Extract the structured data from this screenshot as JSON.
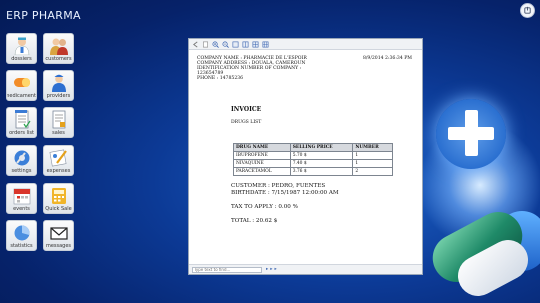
{
  "app": {
    "title": "ERP PHARMA"
  },
  "tiles": [
    {
      "label": "dossiers",
      "icon": "doctor-icon"
    },
    {
      "label": "customers",
      "icon": "customers-icon"
    },
    {
      "label": "medicaments",
      "icon": "medicaments-icon"
    },
    {
      "label": "providers",
      "icon": "providers-icon"
    },
    {
      "label": "orders list",
      "icon": "orders-list-icon"
    },
    {
      "label": "sales",
      "icon": "sales-icon"
    },
    {
      "label": "settings",
      "icon": "settings-icon"
    },
    {
      "label": "expenses",
      "icon": "expenses-icon"
    },
    {
      "label": "events",
      "icon": "calendar-icon"
    },
    {
      "label": "Quick Sale",
      "icon": "quick-sale-icon"
    },
    {
      "label": "statistics",
      "icon": "statistics-icon"
    },
    {
      "label": "messages",
      "icon": "envelope-icon"
    }
  ],
  "viewer": {
    "find_placeholder": "Type text to find...",
    "report": {
      "company_line": "COMPANY NAME : PHARMACIE DE L'ESPOIR",
      "address_line": "COMPANY ADDRESS : DOUALA, CAMEROUN",
      "id_line": "IDENTIFICATION NUMBER OF COMPANY : 123654789",
      "phone_line": "PHONE : 14785236",
      "date": "8/9/2014 2:36:34 PM",
      "invoice_title": "INVOICE",
      "drugs_title": "DRUGS LIST",
      "table": {
        "headers": [
          "DRUG NAME",
          "SELLING PRICE",
          "NUMBER"
        ],
        "rows": [
          [
            "IBUPROFENE",
            "5.70 $",
            "1"
          ],
          [
            "NIVAQUINE",
            "7.40 $",
            "1"
          ],
          [
            "PARACETAMOL",
            "3.76 $",
            "2"
          ]
        ]
      },
      "customer_line": "CUSTOMER : PEDRO, FUENTES",
      "birthdate_line": "BIRTHDATE : 7/15/1987 12:00:00 AM",
      "tax_line": "TAX TO APPLY : 0.00 %",
      "total_line": "TOTAL : 20.62 $"
    }
  }
}
